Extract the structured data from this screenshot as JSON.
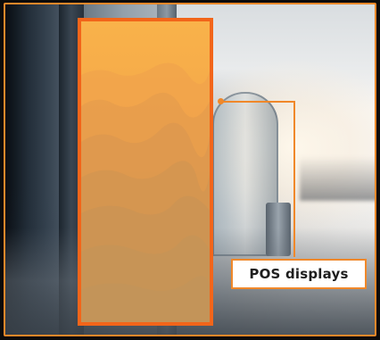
{
  "callout": {
    "label": "POS displays"
  },
  "colors": {
    "accent": "#f0882a",
    "panel_border": "#f2651a",
    "panel_fill": "#f3a64a",
    "label_background": "#ffffff",
    "label_text": "#1e1e1e"
  },
  "scene": {
    "background_icon": "airport-concourse-photo",
    "panel_art_icon": "mountain-ridges-illustration"
  }
}
